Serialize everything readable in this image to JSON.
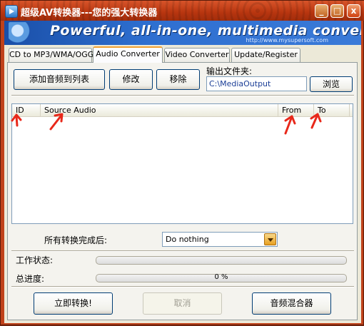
{
  "window": {
    "title": "超级AV转换器---您的强大转换器",
    "minimize_symbol": "_",
    "maximize_symbol": "□",
    "close_symbol": "x"
  },
  "banner": {
    "headline": "Powerful, all-in-one, multimedia converter!",
    "url": "http://www.mysupersoft.com"
  },
  "tabs": [
    {
      "label": "CD to MP3/WMA/OGG",
      "active": false
    },
    {
      "label": "Audio Converter",
      "active": true
    },
    {
      "label": "Video Converter",
      "active": false
    },
    {
      "label": "Update/Register",
      "active": false
    }
  ],
  "toolbar": {
    "add_label": "添加音频到列表",
    "edit_label": "修改",
    "remove_label": "移除"
  },
  "output": {
    "label": "输出文件夹:",
    "folder": "C:\\MediaOutput",
    "browse_label": "浏览"
  },
  "list": {
    "columns": [
      "ID",
      "Source Audio",
      "From",
      "To"
    ],
    "rows": []
  },
  "after_convert": {
    "label": "所有转换完成后:",
    "selected": "Do nothing"
  },
  "status": {
    "work_label": "工作状态:",
    "work_progress": 0,
    "total_label": "总进度:",
    "total_progress": 0,
    "total_text": "0 %"
  },
  "actions": {
    "convert_label": "立即转换!",
    "cancel_label": "取消",
    "mixer_label": "音频混合器"
  },
  "colors": {
    "title_bar": "#c0421a",
    "banner": "#2e6fd0",
    "annotation_arrow": "#e8281a"
  }
}
